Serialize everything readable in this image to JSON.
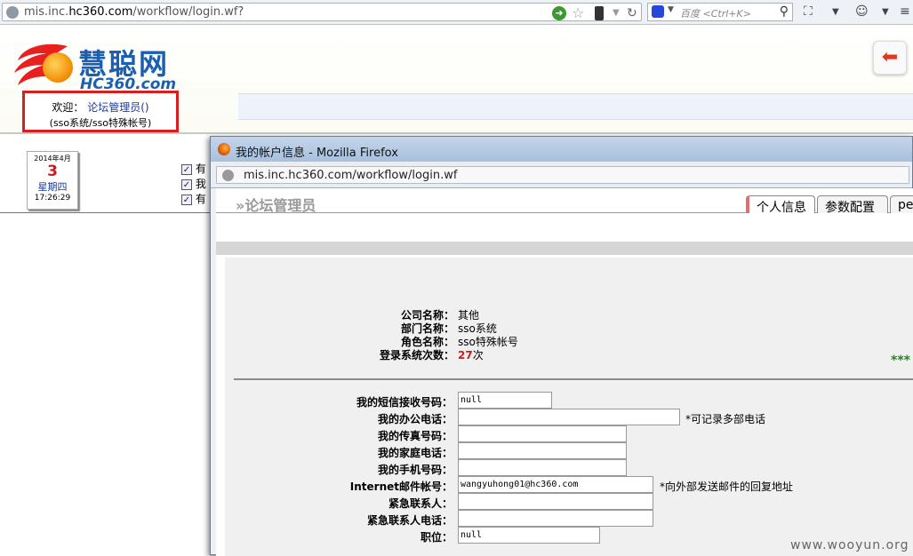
{
  "browser": {
    "url_prefix": "mis.inc.",
    "url_host": "hc360.com",
    "url_path": "/workflow/login.wf?",
    "search_placeholder": "百度 <Ctrl+K>"
  },
  "header": {
    "logo_cn": "慧聪网",
    "logo_en": "HC360.com",
    "welcome_label": "欢迎：",
    "welcome_user": "论坛管理员()",
    "welcome_sub": "(sso系统/sso特殊帐号)"
  },
  "calendar": {
    "year_month": "2014年4月",
    "day": "3",
    "weekday": "星期四",
    "time": "17:26:29"
  },
  "checklist": [
    "有",
    "我",
    "有"
  ],
  "popup": {
    "title": "我的帐户信息 - Mozilla Firefox",
    "url": "mis.inc.hc360.com/workflow/login.wf",
    "heading": "论坛管理员",
    "tabs": {
      "personal": "个人信息",
      "params": "参数配置",
      "pe": "pe"
    },
    "info": {
      "company_label": "公司名称：",
      "company": "其他",
      "dept_label": "部门名称：",
      "dept": "sso系统",
      "role_label": "角色名称：",
      "role": "sso特殊帐号",
      "logins_label": "登录系统次数：",
      "logins": "27",
      "logins_unit": "次"
    },
    "stars": "***",
    "form": {
      "sms_label": "我的短信接收号码：",
      "sms_value": "null",
      "office_label": "我的办公电话：",
      "office_value": "",
      "office_note": "*可记录多部电话",
      "fax_label": "我的传真号码：",
      "fax_value": "",
      "home_label": "我的家庭电话：",
      "home_value": "",
      "mobile_label": "我的手机号码：",
      "mobile_value": "",
      "email_label": "Internet邮件帐号：",
      "email_value": "wangyuhong01@hc360.com",
      "email_note": "*向外部发送邮件的回复地址",
      "emergency_label": "紧急联系人：",
      "emergency_value": "",
      "emergency_phone_label": "紧急联系人电话：",
      "emergency_phone_value": "",
      "position_label": "职位：",
      "position_value": "null"
    }
  },
  "watermark": "www.wooyun.org"
}
